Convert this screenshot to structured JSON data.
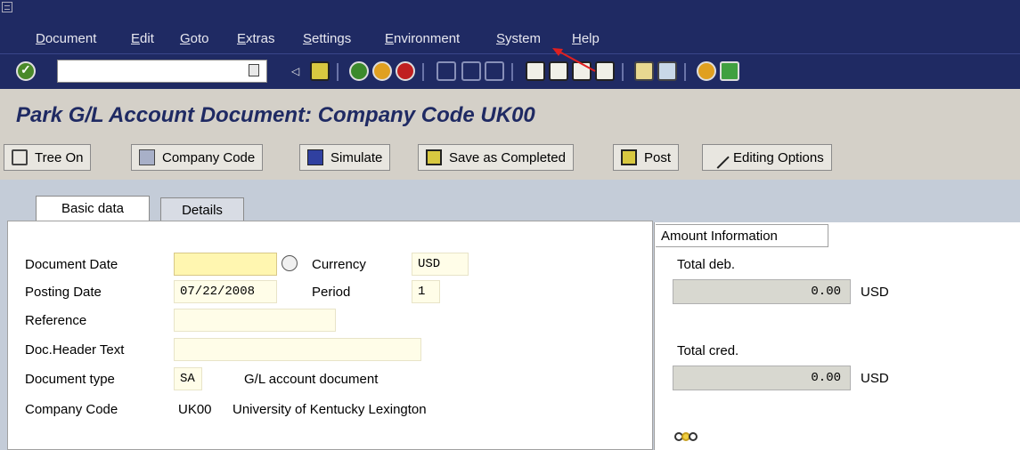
{
  "menu": [
    "Document",
    "Edit",
    "Goto",
    "Extras",
    "Settings",
    "Environment",
    "System",
    "Help"
  ],
  "toolbar": {
    "command_value": ""
  },
  "title": "Park G/L Account Document: Company Code UK00",
  "app_buttons": [
    "Tree On",
    "Company Code",
    "Simulate",
    "Save as Completed",
    "Post",
    "Editing Options"
  ],
  "tabs": {
    "basic": "Basic data",
    "details": "Details"
  },
  "form": {
    "doc_date_label": "Document Date",
    "doc_date_value": "",
    "posting_date_label": "Posting Date",
    "posting_date_value": "07/22/2008",
    "reference_label": "Reference",
    "reference_value": "",
    "header_text_label": "Doc.Header Text",
    "header_text_value": "",
    "doc_type_label": "Document type",
    "doc_type_value": "SA",
    "doc_type_desc": "G/L account document",
    "company_code_label": "Company Code",
    "company_code_value": "UK00",
    "company_code_desc": "University of Kentucky Lexington",
    "currency_label": "Currency",
    "currency_value": "USD",
    "period_label": "Period",
    "period_value": "1"
  },
  "amount": {
    "tab": "Amount Information",
    "total_deb_label": "Total deb.",
    "total_deb_value": "0.00",
    "total_deb_currency": "USD",
    "total_cred_label": "Total cred.",
    "total_cred_value": "0.00",
    "total_cred_currency": "USD"
  },
  "colors": {
    "title": "#1f2a63",
    "menubar": "#1f2a63",
    "annotation_arrow": "#e02020"
  }
}
